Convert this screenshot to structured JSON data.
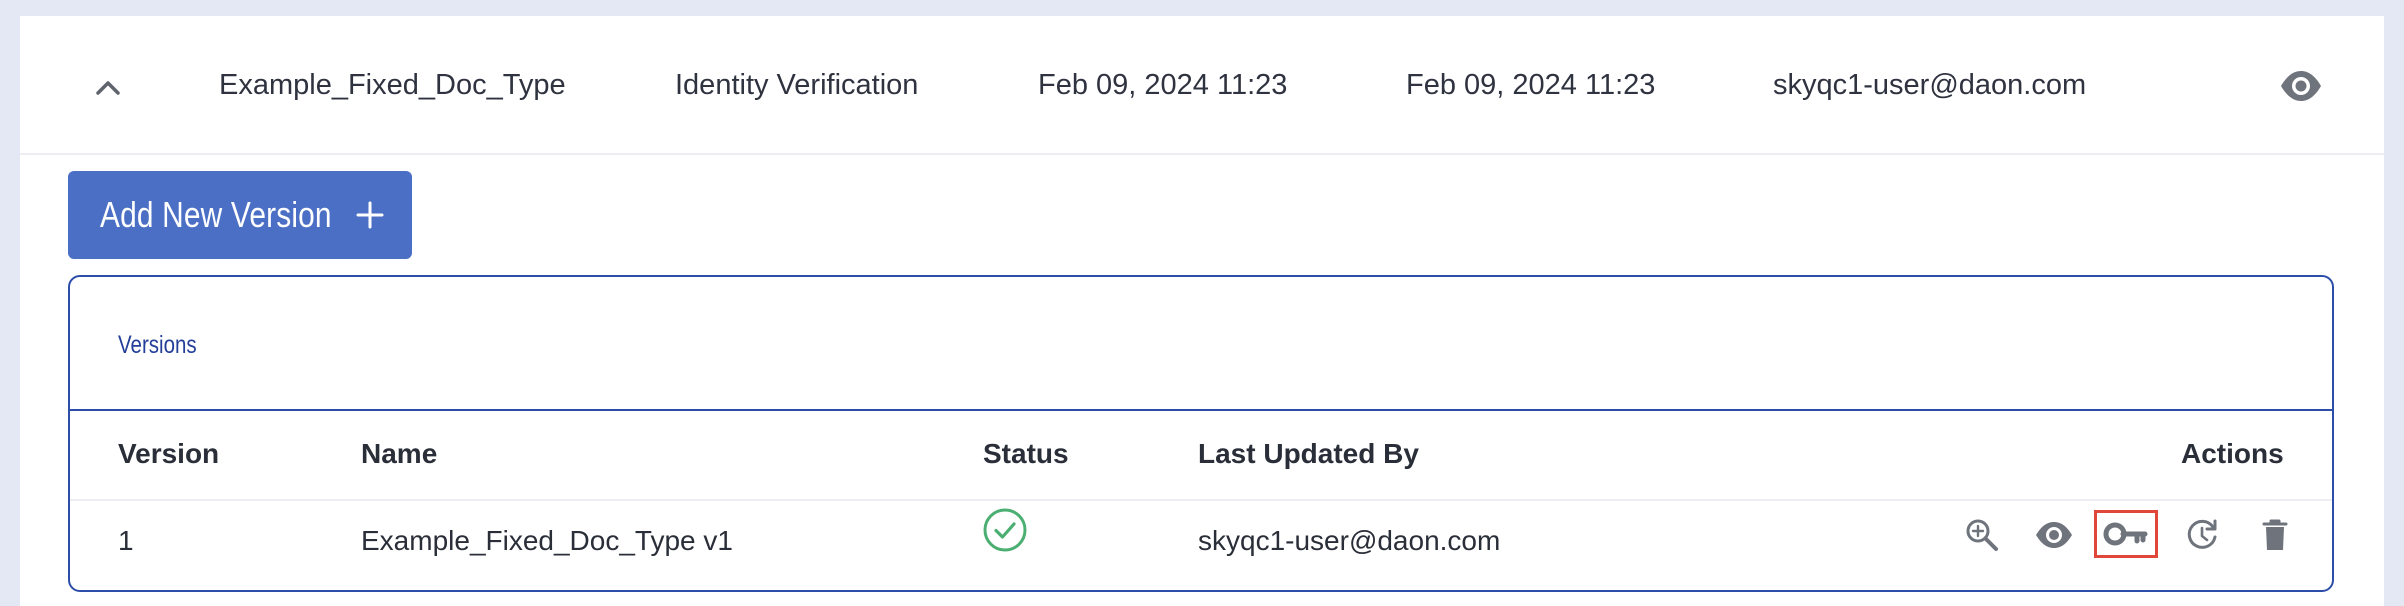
{
  "summary": {
    "name": "Example_Fixed_Doc_Type",
    "category": "Identity Verification",
    "created": "Feb 09, 2024 11:23",
    "updated": "Feb 09, 2024 11:23",
    "user": "skyqc1-user@daon.com",
    "collapse_icon": "chevron-up-icon",
    "view_icon": "eye-icon"
  },
  "add_button": {
    "label": "Add New Version",
    "icon": "plus-icon"
  },
  "versions": {
    "title": "Versions",
    "columns": [
      "Version",
      "Name",
      "Status",
      "Last Updated By",
      "Actions"
    ],
    "rows": [
      {
        "version": "1",
        "name": "Example_Fixed_Doc_Type v1",
        "status": "active",
        "status_icon": "check-circle-icon",
        "last_updated_by": "skyqc1-user@daon.com",
        "actions": [
          "zoom-in-icon",
          "eye-icon",
          "key-icon",
          "history-icon",
          "trash-icon"
        ]
      }
    ]
  },
  "colors": {
    "accent": "#4b6fc4",
    "border": "#2d4ea8",
    "status_ok": "#4caf72",
    "highlight": "#e0473a",
    "icon_gray": "#6f737c"
  }
}
